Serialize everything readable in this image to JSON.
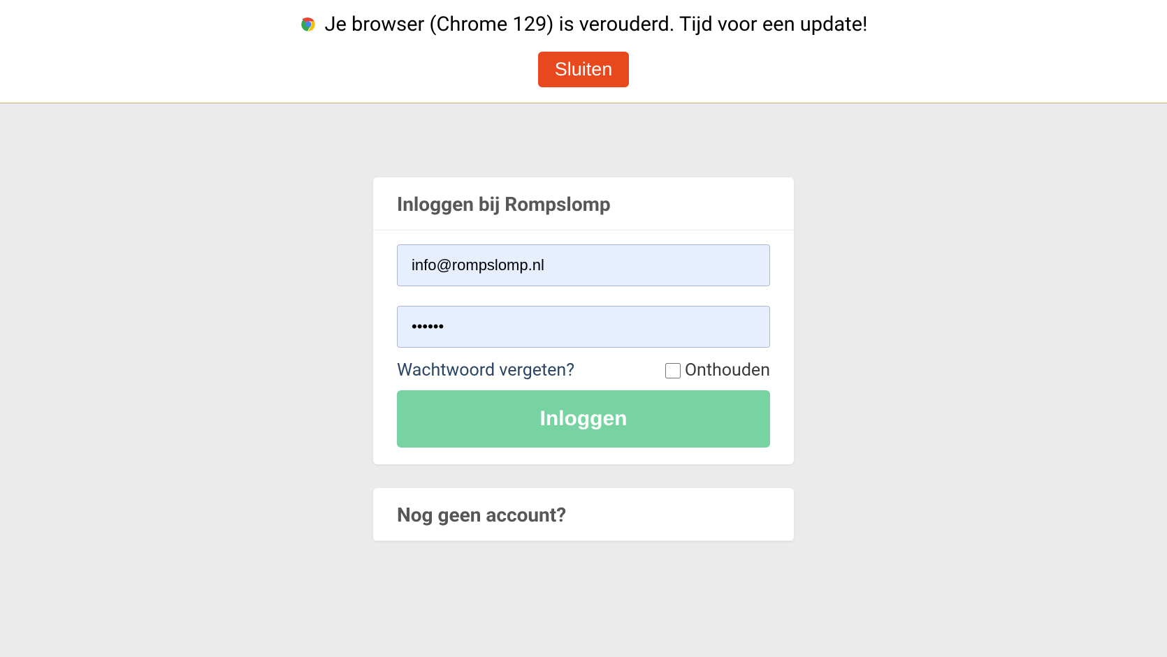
{
  "banner": {
    "message": "Je browser (Chrome 129) is verouderd. Tijd voor een update!",
    "close_label": "Sluiten"
  },
  "login_card": {
    "title": "Inloggen bij Rompslomp",
    "email_value": "info@rompslomp.nl",
    "password_value": "••••••",
    "forgot_label": "Wachtwoord vergeten?",
    "remember_label": "Onthouden",
    "submit_label": "Inloggen"
  },
  "signup_card": {
    "title": "Nog geen account?"
  }
}
